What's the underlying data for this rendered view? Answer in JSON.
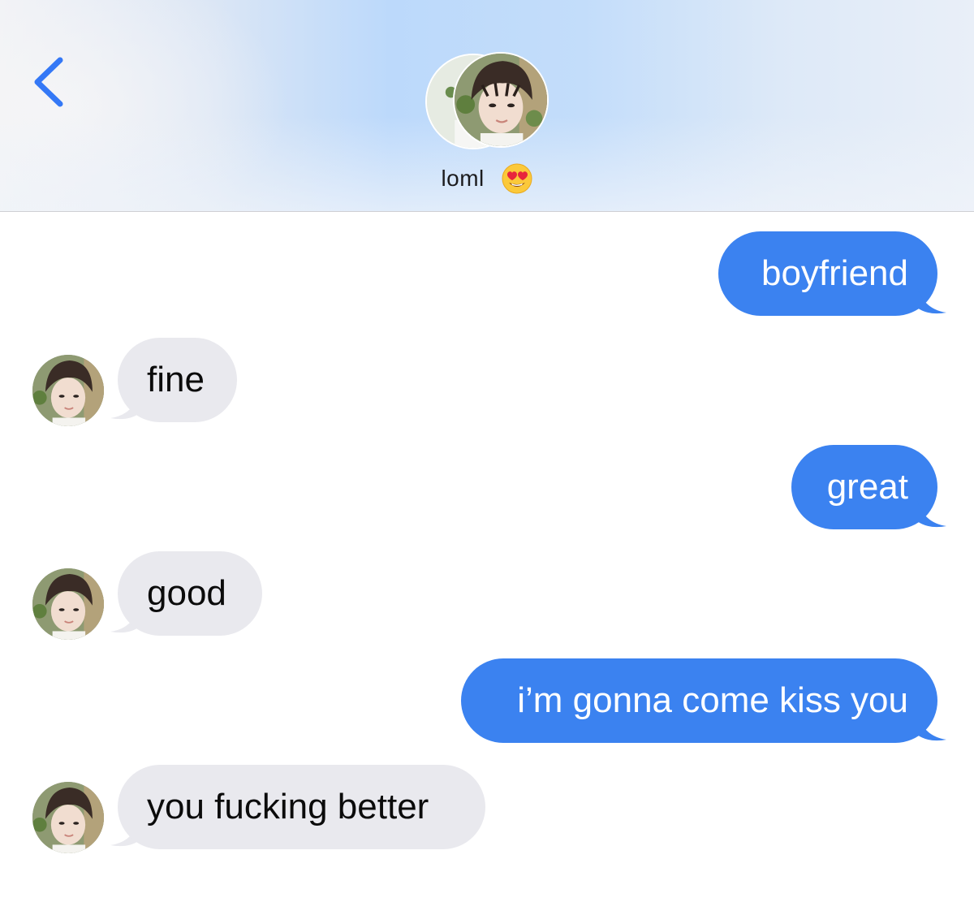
{
  "header": {
    "back_icon": "chevron-left-icon",
    "contact_name": "loml",
    "contact_emoji": "heart-eyes-icon",
    "accent_color": "#3478f6"
  },
  "messages": [
    {
      "direction": "outgoing",
      "text": "boyfriend"
    },
    {
      "direction": "incoming",
      "text": "fine"
    },
    {
      "direction": "outgoing",
      "text": "great"
    },
    {
      "direction": "incoming",
      "text": "good"
    },
    {
      "direction": "outgoing",
      "text": "i’m gonna come kiss you"
    },
    {
      "direction": "incoming",
      "text": "you fucking better"
    }
  ],
  "colors": {
    "outgoing_bubble": "#3b82f0",
    "incoming_bubble": "#e9e9ee",
    "outgoing_text": "#ffffff",
    "incoming_text": "#0b0b0b"
  }
}
